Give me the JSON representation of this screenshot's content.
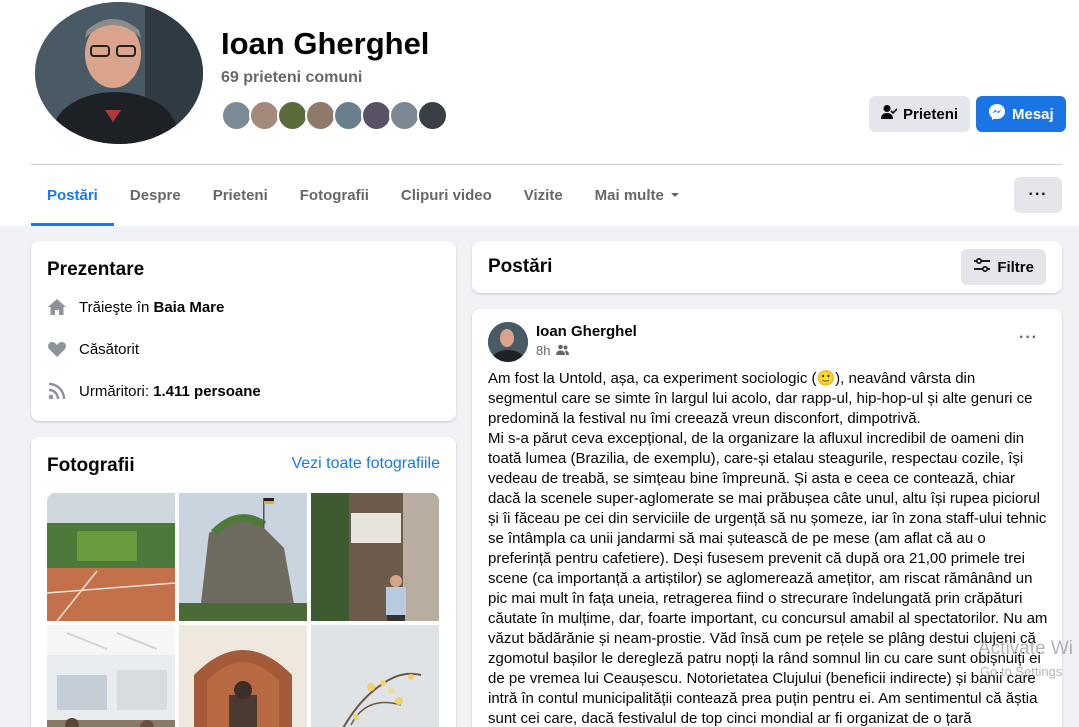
{
  "profile": {
    "name": "Ioan Gherghel",
    "mutual_friends": "69 prieteni comuni",
    "buttons": {
      "friends": "Prieteni",
      "message": "Mesaj"
    }
  },
  "tabs": [
    {
      "label": "Postări",
      "active": true
    },
    {
      "label": "Despre"
    },
    {
      "label": "Prieteni"
    },
    {
      "label": "Fotografii"
    },
    {
      "label": "Clipuri video"
    },
    {
      "label": "Vizite"
    },
    {
      "label": "Mai multe"
    }
  ],
  "more_button": "···",
  "intro": {
    "title": "Prezentare",
    "lives_prefix": "Trăieşte în",
    "lives_city": "Baia Mare",
    "relationship": "Căsătorit",
    "followers_prefix": "Urmăritori:",
    "followers_value": "1.411 persoane"
  },
  "photos": {
    "title": "Fotografii",
    "see_all": "Vezi toate fotografiile"
  },
  "posts_header": {
    "title": "Postări",
    "filter": "Filtre"
  },
  "post": {
    "author": "Ioan Gherghel",
    "time": "8h",
    "menu": "···",
    "text_1": "Am fost la Untold, așa, ca experiment sociologic (🙂), neavând vârsta din segmentul care se simte în largul lui acolo, dar rapp-ul, hip-hop-ul și alte genuri ce predomină la festival nu îmi creează vreun disconfort, dimpotrivă.",
    "text_2": "Mi s-a părut ceva excepțional, de la organizare   la afluxul incredibil de oameni din toată lumea (Brazilia, de exemplu), care-și etalau steagurile, respectau cozile, își vedeau de treabă, se simțeau bine împreună. Și asta e ceea ce contează, chiar dacă la scenele super-aglomerate se mai prăbușea câte unul, altu își rupea piciorul și îi făceau pe cei din serviciile de urgență să nu șomeze, iar în zona staff-ului tehnic se întâmpla ca unii jandarmi să mai șutească de pe mese (am aflat că au o preferință pentru cafetiere). Deși fusesem prevenit că după ora 21,00 primele trei scene (ca importanță a artiștilor) se aglomerează amețitor, am riscat rămânând un pic mai mult în fața uneia, retragerea fiind o strecurare îndelungată prin crăpături căutate în mulțime, dar, foarte important, cu concursul amabil al spectatorilor. Nu am văzut bădărănie și neam-prostie. Văd însă cum pe rețele se plâng destui clujeni că zgomotul bașilor le deregleză patru nopți la rând somnul lin cu care sunt obișnuiți ei de pe vremea lui Ceaușescu. Notorietatea Clujului (beneficii indirecte) și banii care intră în contul municipalității contează prea puțin pentru ei. Am sentimentul că ăștia sunt cei care, dacă festivalul de top cinci mondial ar fi organizat de o țară"
  },
  "watermark": {
    "line1": "Activate Wi",
    "line2": "Go to Settings"
  },
  "colors": {
    "accent": "#1877f2",
    "button_blue": "#1b74e4",
    "bg": "#f0f2f5"
  }
}
